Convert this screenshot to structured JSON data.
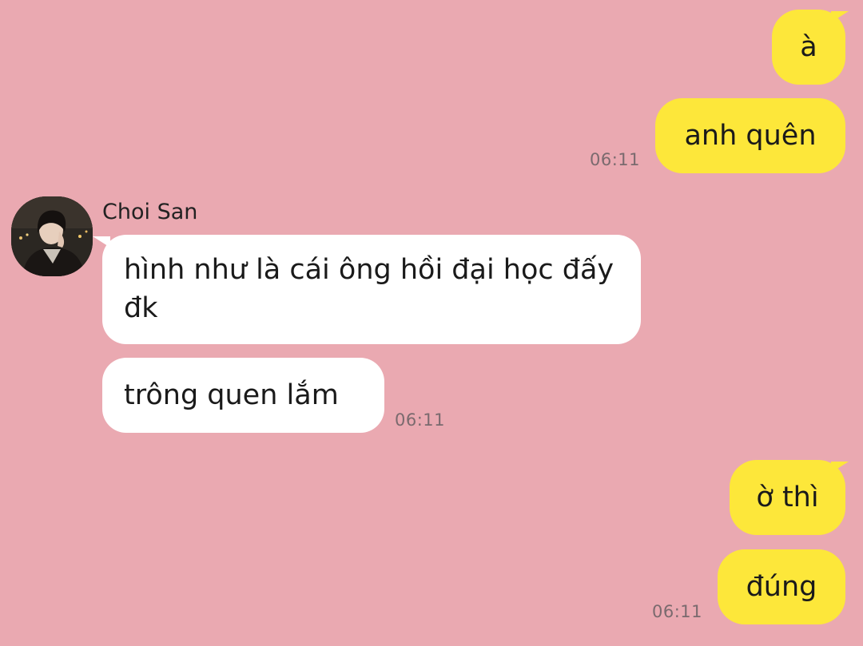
{
  "contact": {
    "name": "Choi San",
    "avatar": "avatar-photo"
  },
  "colors": {
    "background": "#eaa9b1",
    "outgoing_bubble": "#fde73a",
    "incoming_bubble": "#ffffff",
    "timestamp": "#7a6a6e"
  },
  "messages": [
    {
      "sender": "me",
      "text": "à"
    },
    {
      "sender": "me",
      "text": "anh quên",
      "time": "06:11"
    },
    {
      "sender": "Choi San",
      "text": "hình như là cái ông hồi đại học đấy đk"
    },
    {
      "sender": "Choi San",
      "text": "trông quen lắm",
      "time": "06:11"
    },
    {
      "sender": "me",
      "text": "ờ thì"
    },
    {
      "sender": "me",
      "text": "đúng",
      "time": "06:11"
    }
  ]
}
